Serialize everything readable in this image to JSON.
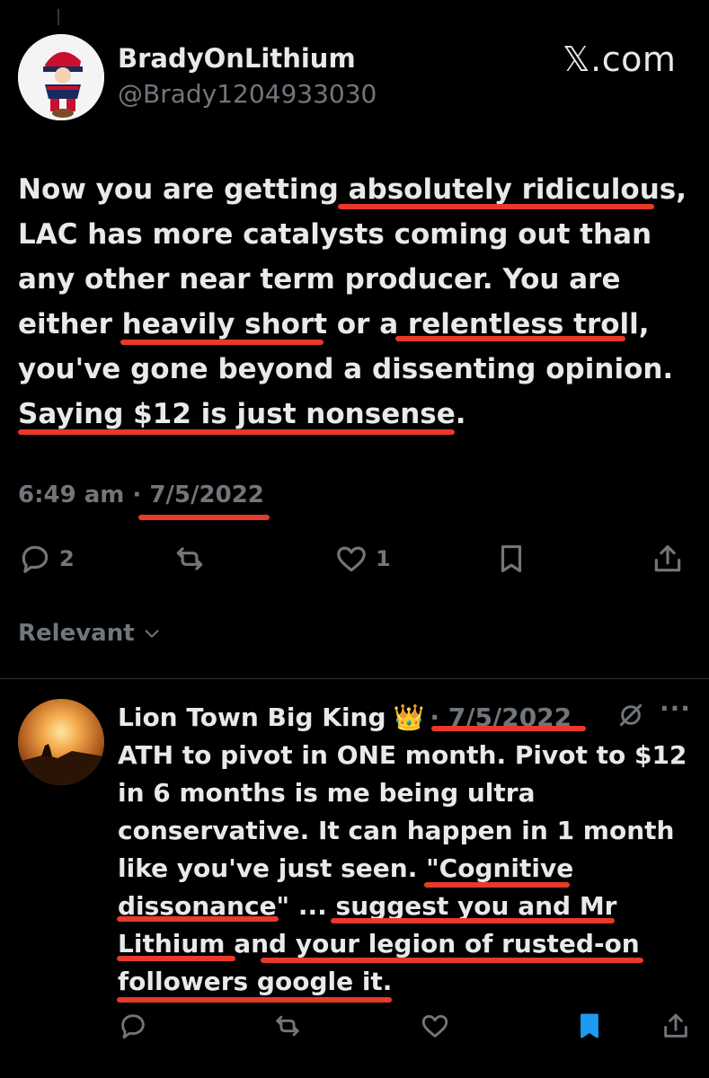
{
  "tweet": {
    "display_name": "BradyOnLithium",
    "handle": "@Brady1204933030",
    "site": "𝕏.com",
    "lines": [
      "Now you are getting absolutely ridiculous,",
      "LAC has more catalysts coming out than",
      "any other near term producer. You are",
      "either heavily short or a relentless troll,",
      "you've gone beyond a dissenting opinion.",
      "Saying $12 is just nonsense."
    ],
    "time": "6:49 am · 7/5/2022",
    "replies": "2",
    "likes": "1"
  },
  "sort_label": "Relevant",
  "reply": {
    "display_name": "Lion Town Big King",
    "crown": "👑",
    "date": "· 7/5/2022",
    "more": "···",
    "lines": [
      "ATH to pivot in ONE month. Pivot to $12",
      "in 6 months is me being ultra",
      "conservative. It can happen in 1 month",
      "like you've just seen. \"Cognitive",
      "dissonance\" ... suggest you and Mr",
      "Lithium and your legion of rusted-on",
      "followers google it."
    ]
  },
  "colors": {
    "background": "#000000",
    "text": "#e7e9ea",
    "muted": "#71767b",
    "annotation_underline": "#e8392a",
    "bookmarked": "#1d9bf0"
  }
}
